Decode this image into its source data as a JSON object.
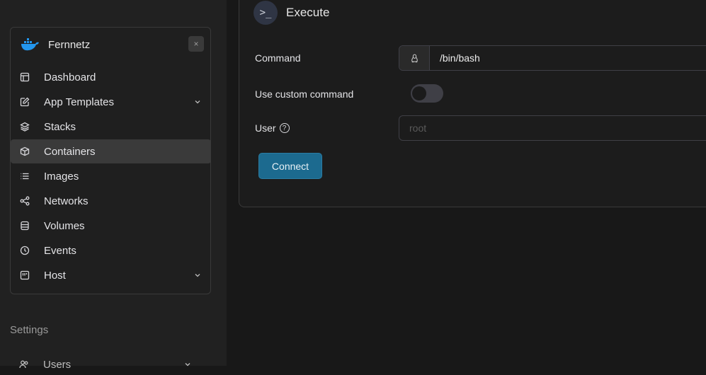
{
  "sidebar": {
    "environment": {
      "name": "Fernnetz",
      "close_icon": "×"
    },
    "items": [
      {
        "label": "Dashboard",
        "icon": "layout-icon"
      },
      {
        "label": "App Templates",
        "icon": "edit-icon",
        "has_chevron": true
      },
      {
        "label": "Stacks",
        "icon": "layers-icon"
      },
      {
        "label": "Containers",
        "icon": "box-icon",
        "active": true
      },
      {
        "label": "Images",
        "icon": "list-icon"
      },
      {
        "label": "Networks",
        "icon": "share-icon"
      },
      {
        "label": "Volumes",
        "icon": "database-icon"
      },
      {
        "label": "Events",
        "icon": "clock-icon"
      },
      {
        "label": "Host",
        "icon": "server-icon",
        "has_chevron": true
      }
    ],
    "settings_label": "Settings",
    "users_label": "Users"
  },
  "panel": {
    "title": "Execute",
    "title_icon": "terminal-icon",
    "command_label": "Command",
    "command_value": "/bin/bash",
    "custom_command_label": "Use custom command",
    "custom_command_enabled": false,
    "user_label": "User",
    "user_placeholder": "root",
    "user_value": "",
    "connect_label": "Connect"
  },
  "colors": {
    "accent": "#1c6a8f",
    "sidebar_bg": "#212121",
    "main_bg": "#181818",
    "active_item_bg": "#3a3a3a"
  }
}
